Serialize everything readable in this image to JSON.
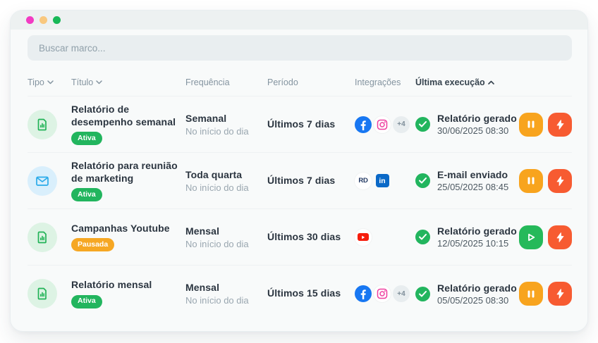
{
  "window": {
    "traffic_lights": {
      "pink": "#f23cc3",
      "peach": "#f9c87e",
      "green": "#17b857"
    }
  },
  "search": {
    "placeholder": "Buscar marco..."
  },
  "colors": {
    "badge_active": "#22b55e",
    "badge_paused": "#f6a723",
    "facebook": "#1877f2",
    "instagram": "#ef3f9f",
    "linkedin": "#0b69c7",
    "youtube": "#f61d0c",
    "success": "#22b55e",
    "pause_button": "#f8a41e",
    "play_button": "#25b95a",
    "run_button": "#f75b31"
  },
  "icons": {
    "linkedin_label": "in",
    "rd_label": "RD"
  },
  "table": {
    "headers": {
      "tipo": "Tipo",
      "titulo": "Título",
      "frequencia": "Frequência",
      "periodo": "Período",
      "integracoes": "Integrações",
      "ultima_execucao": "Última execução"
    },
    "rows": [
      {
        "type_icon": "report-chart",
        "title": "Relatório de desempenho semanal",
        "badge": "Ativa",
        "frequency": "Semanal",
        "frequency_detail": "No início do dia",
        "period": "Últimos 7 dias",
        "integrations_more": "+4",
        "last_run_status": "Relatório gerado",
        "last_run_date": "30/06/2025  08:30"
      },
      {
        "type_icon": "email",
        "title": "Relatório para reunião de marketing",
        "badge": "Ativa",
        "frequency": "Toda quarta",
        "frequency_detail": "No início do dia",
        "period": "Últimos 7 dias",
        "last_run_status": "E-mail enviado",
        "last_run_date": "25/05/2025  08:45"
      },
      {
        "type_icon": "report-chart",
        "title": "Campanhas Youtube",
        "badge": "Pausada",
        "frequency": "Mensal",
        "frequency_detail": "No início do dia",
        "period": "Últimos 30 dias",
        "last_run_status": "Relatório gerado",
        "last_run_date": "12/05/2025  10:15"
      },
      {
        "type_icon": "report-chart",
        "title": "Relatório mensal",
        "badge": "Ativa",
        "frequency": "Mensal",
        "frequency_detail": "No início do dia",
        "period": "Últimos 15 dias",
        "integrations_more": "+4",
        "last_run_status": "Relatório gerado",
        "last_run_date": "05/05/2025  08:30"
      }
    ]
  }
}
